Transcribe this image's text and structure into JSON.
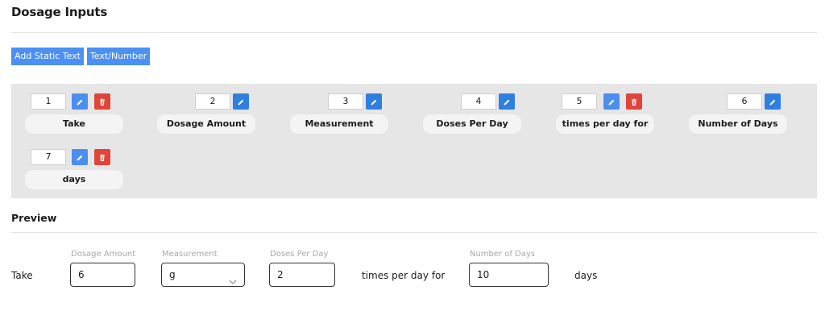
{
  "header": {
    "title": "Dosage Inputs"
  },
  "toolbar": {
    "add_static_text": "Add Static Text",
    "text_number": "Text/Number"
  },
  "inputs": [
    {
      "order": "1",
      "label": "Take",
      "deletable": true
    },
    {
      "order": "2",
      "label": "Dosage Amount",
      "deletable": false
    },
    {
      "order": "3",
      "label": "Measurement",
      "deletable": false
    },
    {
      "order": "4",
      "label": "Doses Per Day",
      "deletable": false
    },
    {
      "order": "5",
      "label": "times per day for",
      "deletable": true
    },
    {
      "order": "6",
      "label": "Number of Days",
      "deletable": false
    },
    {
      "order": "7",
      "label": "days",
      "deletable": true
    }
  ],
  "preview": {
    "title": "Preview",
    "take_text": "Take",
    "dosage_amount": {
      "caption": "Dosage Amount",
      "value": "6"
    },
    "measurement": {
      "caption": "Measurement",
      "value": "g"
    },
    "doses_per_day": {
      "caption": "Doses Per Day",
      "value": "2"
    },
    "times_per_day_text": "times per day for",
    "number_of_days": {
      "caption": "Number of Days",
      "value": "10"
    },
    "days_text": "days"
  },
  "colors": {
    "edit": "#2f7fe0",
    "delete": "#e0453a",
    "toolbar": "#4a90f5",
    "panel": "#e6e6e6"
  },
  "icons": {
    "edit": "pencil-icon",
    "delete": "trash-icon",
    "select": "chevron-down-icon"
  }
}
